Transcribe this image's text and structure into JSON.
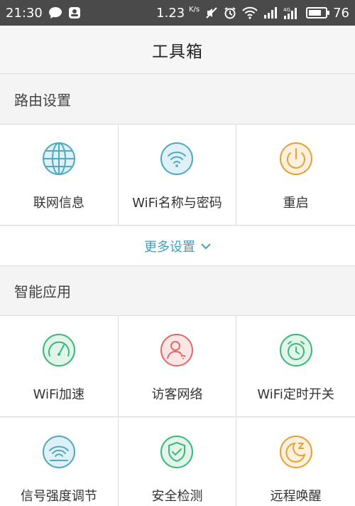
{
  "status_bar": {
    "time": "21:30",
    "net_speed": "1.23",
    "net_speed_unit": "K/s",
    "signal_label": "4G",
    "battery_level": 76,
    "battery_text": "76"
  },
  "header": {
    "title": "工具箱"
  },
  "router_settings": {
    "title": "路由设置",
    "items": [
      {
        "label": "联网信息",
        "icon": "globe-icon",
        "color": "#4fa9c2"
      },
      {
        "label": "WiFi名称与密码",
        "icon": "wifi-icon",
        "color": "#4fa9c2"
      },
      {
        "label": "重启",
        "icon": "power-icon",
        "color": "#e2a23a"
      }
    ],
    "more_label": "更多设置"
  },
  "smart_apps": {
    "title": "智能应用",
    "items": [
      {
        "label": "WiFi加速",
        "icon": "speedometer-icon",
        "color": "#3cb878"
      },
      {
        "label": "访客网络",
        "icon": "guest-user-icon",
        "color": "#e06a6a"
      },
      {
        "label": "WiFi定时开关",
        "icon": "alarm-clock-icon",
        "color": "#3cb878"
      },
      {
        "label": "信号强度调节",
        "icon": "signal-strength-icon",
        "color": "#4fa9c2"
      },
      {
        "label": "安全检测",
        "icon": "shield-check-icon",
        "color": "#3cb878"
      },
      {
        "label": "远程唤醒",
        "icon": "moon-zz-icon",
        "color": "#e2a23a"
      }
    ]
  }
}
